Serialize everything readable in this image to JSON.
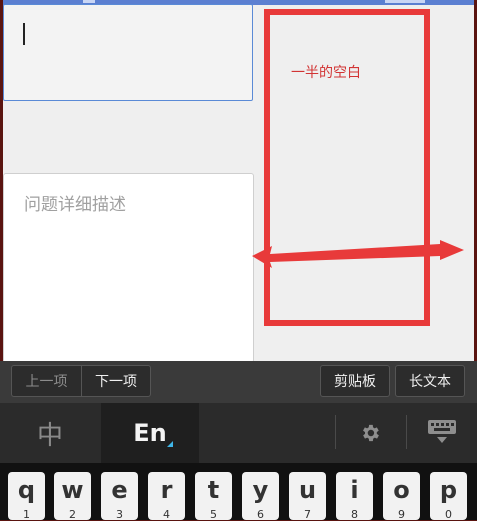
{
  "form": {
    "title_field_value": "",
    "description_placeholder": "问题详细描述"
  },
  "annotation": {
    "note": "一半的空白",
    "color": "#e83a3a"
  },
  "ime_toolbar": {
    "prev_label": "上一项",
    "next_label": "下一项",
    "clipboard_label": "剪贴板",
    "long_text_label": "长文本"
  },
  "mode_bar": {
    "chinese_label": "中",
    "english_label": "En",
    "settings_icon": "gear-icon",
    "hide_keyboard_icon": "keyboard-hide-icon"
  },
  "keys": [
    {
      "char": "q",
      "num": "1"
    },
    {
      "char": "w",
      "num": "2"
    },
    {
      "char": "e",
      "num": "3"
    },
    {
      "char": "r",
      "num": "4"
    },
    {
      "char": "t",
      "num": "5"
    },
    {
      "char": "y",
      "num": "6"
    },
    {
      "char": "u",
      "num": "7"
    },
    {
      "char": "i",
      "num": "8"
    },
    {
      "char": "o",
      "num": "9"
    },
    {
      "char": "p",
      "num": "0"
    }
  ]
}
